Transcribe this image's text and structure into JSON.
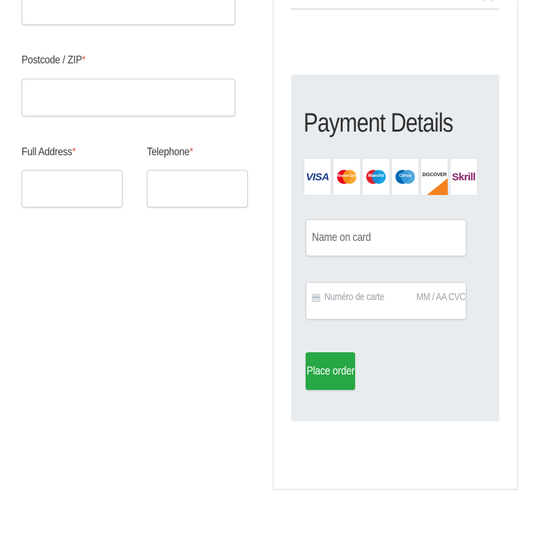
{
  "form": {
    "postcode": {
      "label": "Postcode / ZIP",
      "required_mark": "*",
      "value": ""
    },
    "full_address": {
      "label": "Full Address",
      "required_mark": "*",
      "value": ""
    },
    "telephone": {
      "label": "Telephone",
      "required_mark": "*",
      "value": ""
    }
  },
  "payment": {
    "title": "Payment Details",
    "card_logos": [
      {
        "name": "visa-logo",
        "text": "VISA",
        "color": "#1a3c8b"
      },
      {
        "name": "mastercard-logo",
        "text": "MasterCard",
        "colors": [
          "#eb001b",
          "#f79e1b"
        ]
      },
      {
        "name": "maestro-logo",
        "text": "Maestro",
        "colors": [
          "#e41d2d",
          "#0099df"
        ]
      },
      {
        "name": "cirrus-logo",
        "text": "Cirrus",
        "colors": [
          "#0068b5",
          "#3f9fd8"
        ]
      },
      {
        "name": "discover-logo",
        "text": "DISCOVER",
        "color": "#f58220"
      },
      {
        "name": "skrill-logo",
        "text": "Skrill",
        "color": "#862165"
      }
    ],
    "name_on_card": {
      "placeholder": "Name on card",
      "value": ""
    },
    "card_number": {
      "placeholder": "Numéro de carte",
      "expiry_cvc_placeholder": "MM / AA  CVC",
      "icon": "credit-card-icon"
    },
    "place_order_label": "Place order"
  },
  "colors": {
    "button_green": "#28a745",
    "panel_bg": "#e9ecef",
    "required_red": "#d9534f"
  }
}
